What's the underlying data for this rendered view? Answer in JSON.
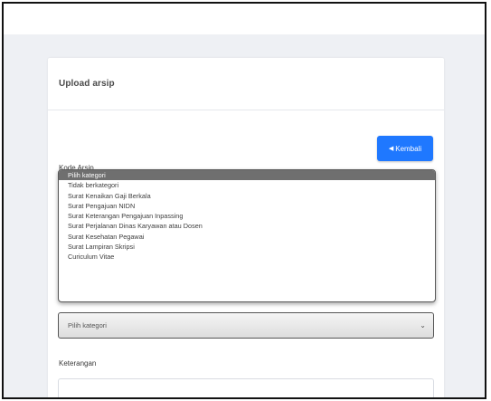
{
  "card": {
    "title": "Upload arsip",
    "back_button": "Kembali"
  },
  "form": {
    "kode_label": "Kode Arsip",
    "select": {
      "selected": "Pilih kategori",
      "options": [
        "Pilih kategori",
        "Tidak berkategori",
        "Surat Kenaikan Gaji Berkala",
        "Surat Pengajuan NIDN",
        "Surat Keterangan Pengajuan Inpassing",
        "Surat Perjalanan Dinas Karyawan atau Dosen",
        "Surat Kesehatan Pegawai",
        "Surat Lampiran Skripsi",
        "Curiculum Vitae"
      ]
    },
    "keterangan_label": "Keterangan"
  },
  "icons": {
    "back": "arrow-left-icon",
    "select_chevron": "chevron-down-icon"
  },
  "colors": {
    "primary_button": "#1f78ff",
    "selected_option": "#6f6f6f",
    "page_background": "#eef0f4"
  }
}
